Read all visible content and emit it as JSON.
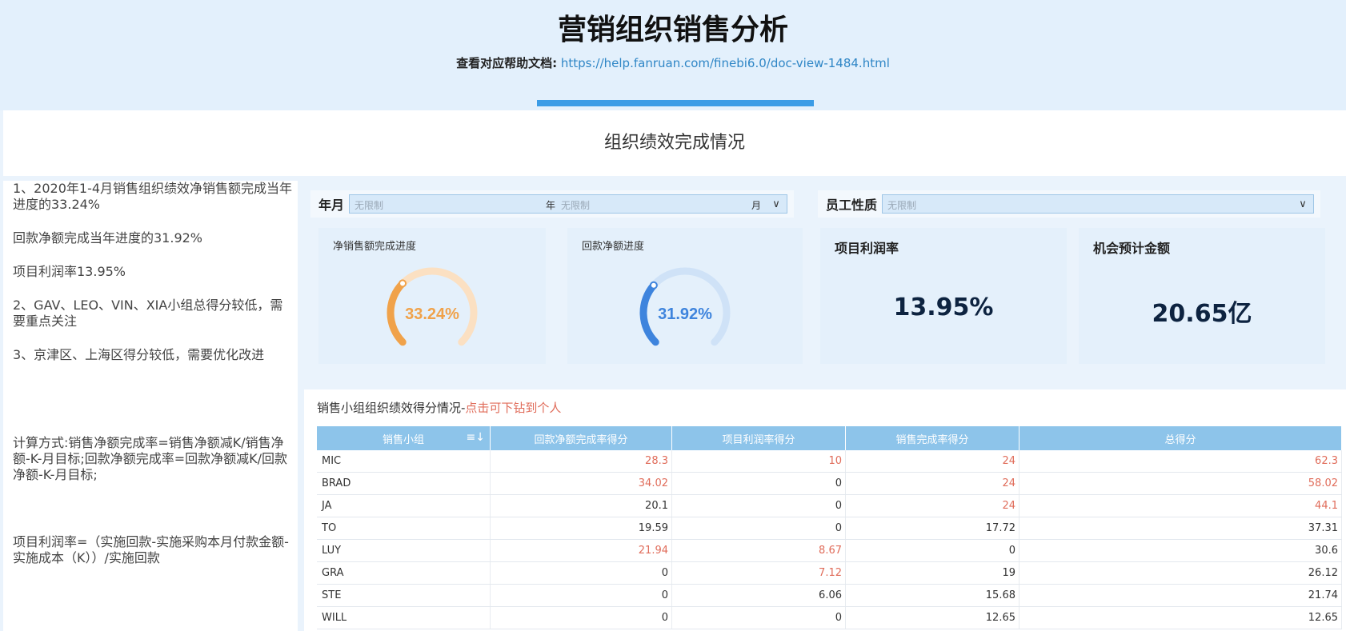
{
  "header": {
    "title": "营销组织销售分析",
    "help_label": "查看对应帮助文档:",
    "help_link": "https://help.fanruan.com/finebi6.0/doc-view-1484.html"
  },
  "section_title": "组织绩效完成情况",
  "notes": {
    "p1": "1、2020年1-4月销售组织绩效净销售额完成当年进度的33.24%",
    "p2": "回款净额完成当年进度的31.92%",
    "p3": "项目利润率13.95%",
    "p4": "2、GAV、LEO、VIN、XIA小组总得分较低，需要重点关注",
    "p5": "3、京津区、上海区得分较低，需要优化改进",
    "p6": "计算方式:销售净额完成率=销售净额减K/销售净额-K-月目标;回款净额完成率=回款净额减K/回款净额-K-月目标;",
    "p7": "项目利润率=（实施回款-实施采购本月付款金额-实施成本（K））/实施回款"
  },
  "filters": {
    "yearmonth": {
      "label": "年月",
      "placeholder1": "无限制",
      "unit_year": "年",
      "placeholder2": "无限制",
      "unit_month": "月"
    },
    "staff": {
      "label": "员工性质",
      "placeholder": "无限制"
    }
  },
  "cards": {
    "sales_progress": {
      "title": "净销售额完成进度",
      "value_text": "33.24%",
      "fraction": 0.3324,
      "color": "#f0a24a",
      "track": "#fbe0c2"
    },
    "payment_progress": {
      "title": "回款净额进度",
      "value_text": "31.92%",
      "fraction": 0.3192,
      "color": "#3e84dd",
      "track": "#cfe2f7"
    },
    "profit_rate": {
      "title": "项目利润率",
      "value": "13.95%"
    },
    "opportunity": {
      "title": "机会预计金额",
      "value": "20.65亿"
    }
  },
  "table": {
    "title_prefix": "销售小组组织绩效得分情况-",
    "title_highlight": "点击可下钻到个人",
    "columns": [
      "销售小组",
      "回款净额完成率得分",
      "项目利润率得分",
      "销售完成率得分",
      "总得分"
    ],
    "rows": [
      [
        "MIC",
        "28.3",
        "10",
        "24",
        "62.3"
      ],
      [
        "BRAD",
        "34.02",
        "0",
        "24",
        "58.02"
      ],
      [
        "JA",
        "20.1",
        "0",
        "24",
        "44.1"
      ],
      [
        "TO",
        "19.59",
        "0",
        "17.72",
        "37.31"
      ],
      [
        "LUY",
        "21.94",
        "8.67",
        "0",
        "30.6"
      ],
      [
        "GRA",
        "0",
        "7.12",
        "19",
        "26.12"
      ],
      [
        "STE",
        "0",
        "6.06",
        "15.68",
        "21.74"
      ],
      [
        "WILL",
        "0",
        "0",
        "12.65",
        "12.65"
      ]
    ],
    "highlight": [
      [
        true,
        true,
        true,
        true
      ],
      [
        true,
        false,
        true,
        true
      ],
      [
        false,
        false,
        true,
        true
      ],
      [
        false,
        false,
        false,
        false
      ],
      [
        true,
        true,
        false,
        false
      ],
      [
        false,
        true,
        false,
        false
      ],
      [
        false,
        false,
        false,
        false
      ],
      [
        false,
        false,
        false,
        false
      ]
    ]
  }
}
